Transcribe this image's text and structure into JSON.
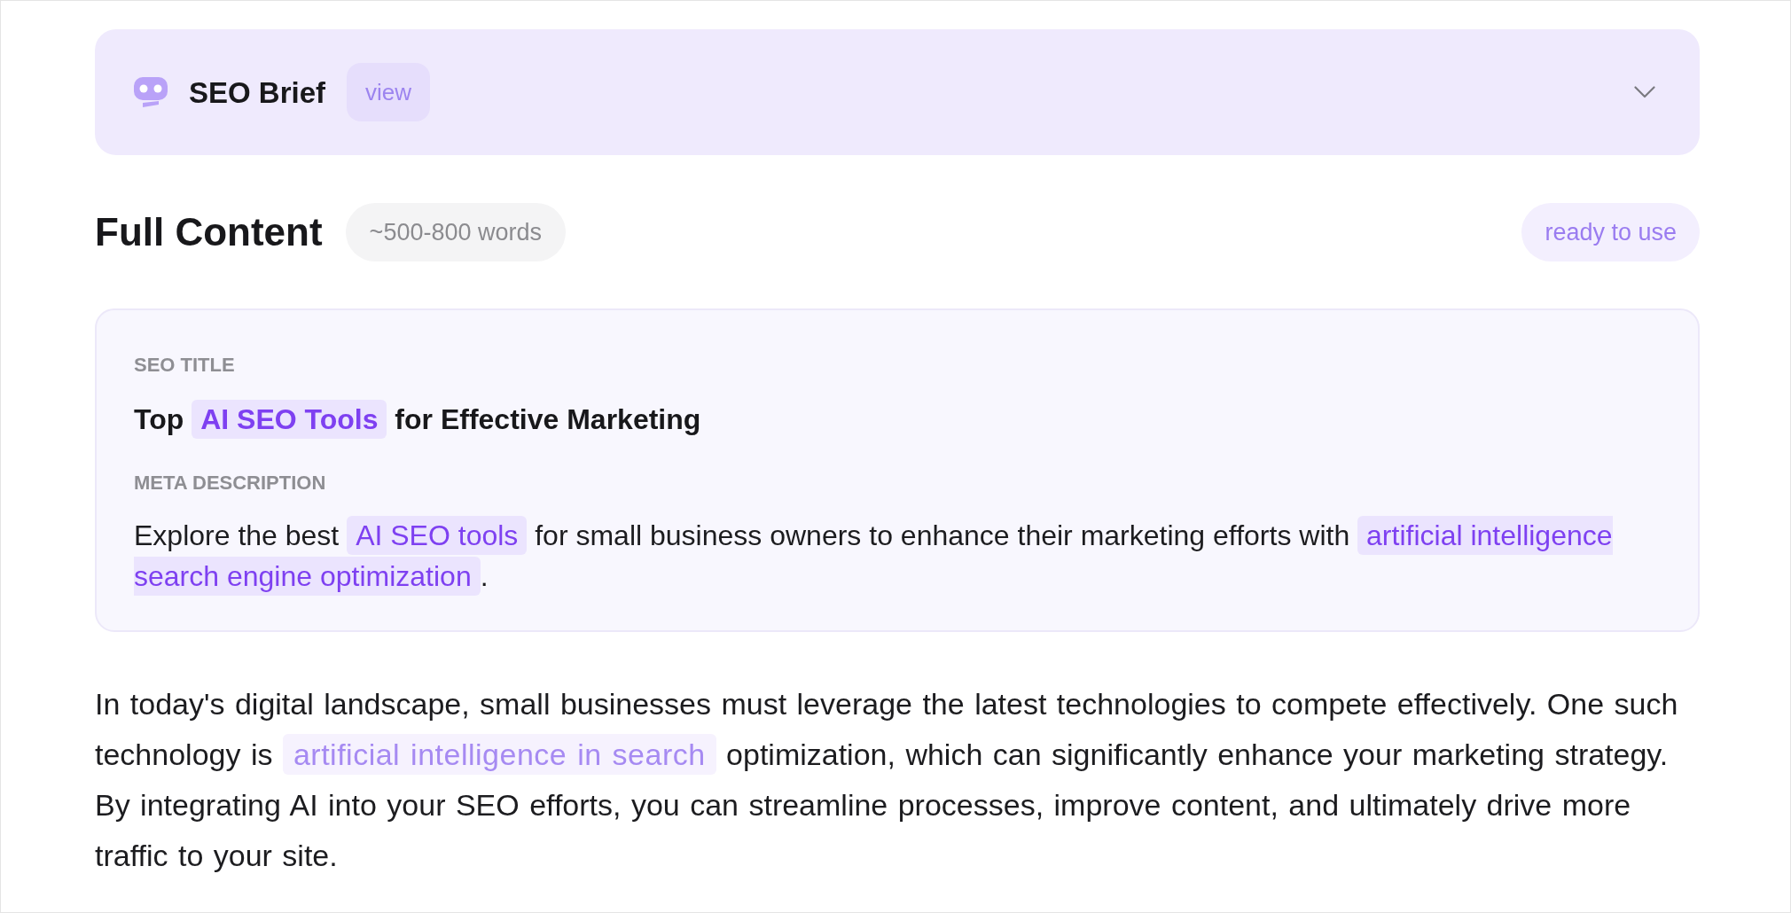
{
  "brief": {
    "title": "SEO Brief",
    "view_label": "view",
    "expanded": false
  },
  "full_content": {
    "heading": "Full Content",
    "word_range": "~500-800 words",
    "status": "ready to use"
  },
  "seo_card": {
    "fields": [
      {
        "kind": "title",
        "label": "SEO TITLE",
        "segments": [
          {
            "text": "Top ",
            "highlight": false
          },
          {
            "text": "AI SEO Tools",
            "highlight": true
          },
          {
            "text": " for Effective Marketing",
            "highlight": false
          }
        ]
      },
      {
        "kind": "description",
        "label": "META DESCRIPTION",
        "segments": [
          {
            "text": "Explore the best ",
            "highlight": false
          },
          {
            "text": "AI SEO tools",
            "highlight": true
          },
          {
            "text": " for small business owners to enhance their marketing efforts with ",
            "highlight": false
          },
          {
            "text": "artificial intelligence search engine optimization",
            "highlight": true
          },
          {
            "text": ".",
            "highlight": false
          }
        ]
      }
    ]
  },
  "body": [
    {
      "segments": [
        {
          "text": "In today's digital landscape, small businesses must leverage the latest technologies to compete effectively. One such technology is ",
          "highlight": false
        },
        {
          "text": "artificial intelligence in search",
          "highlight": true
        },
        {
          "text": " optimization, which can significantly enhance your marketing strategy. By integrating AI into your SEO efforts, you can streamline processes, improve content, and ultimately drive more traffic to your site.",
          "highlight": false
        }
      ]
    }
  ]
}
